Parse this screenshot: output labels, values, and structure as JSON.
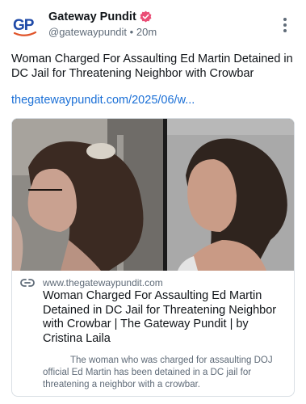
{
  "account": {
    "name": "Gateway Pundit",
    "handle": "@gatewaypundit",
    "separator": "•",
    "time": "20m",
    "avatar_initials": "GP",
    "verified_icon": "verified-badge-icon",
    "brand_color": "#1f4aa8",
    "accent_color": "#e0542a"
  },
  "post": {
    "text": "Woman Charged For Assaulting Ed Martin Detained in DC Jail for Threatening Neighbor with Crowbar",
    "link_text": "thegatewaypundit.com/2025/06/w...",
    "link_color": "#1a6fd6"
  },
  "card": {
    "domain": "www.thegatewaypundit.com",
    "title": "Woman Charged For Assaulting Ed Martin Detained in DC Jail for Threatening Neighbor with Crowbar | The Gateway Pundit | by Cristina Laila",
    "description": "The woman who was charged for assaulting DOJ official Ed Martin has been detained in a DC jail for threatening a neighbor with a crowbar.",
    "link_icon": "link-icon"
  },
  "menu": {
    "icon": "more-vertical-icon"
  }
}
